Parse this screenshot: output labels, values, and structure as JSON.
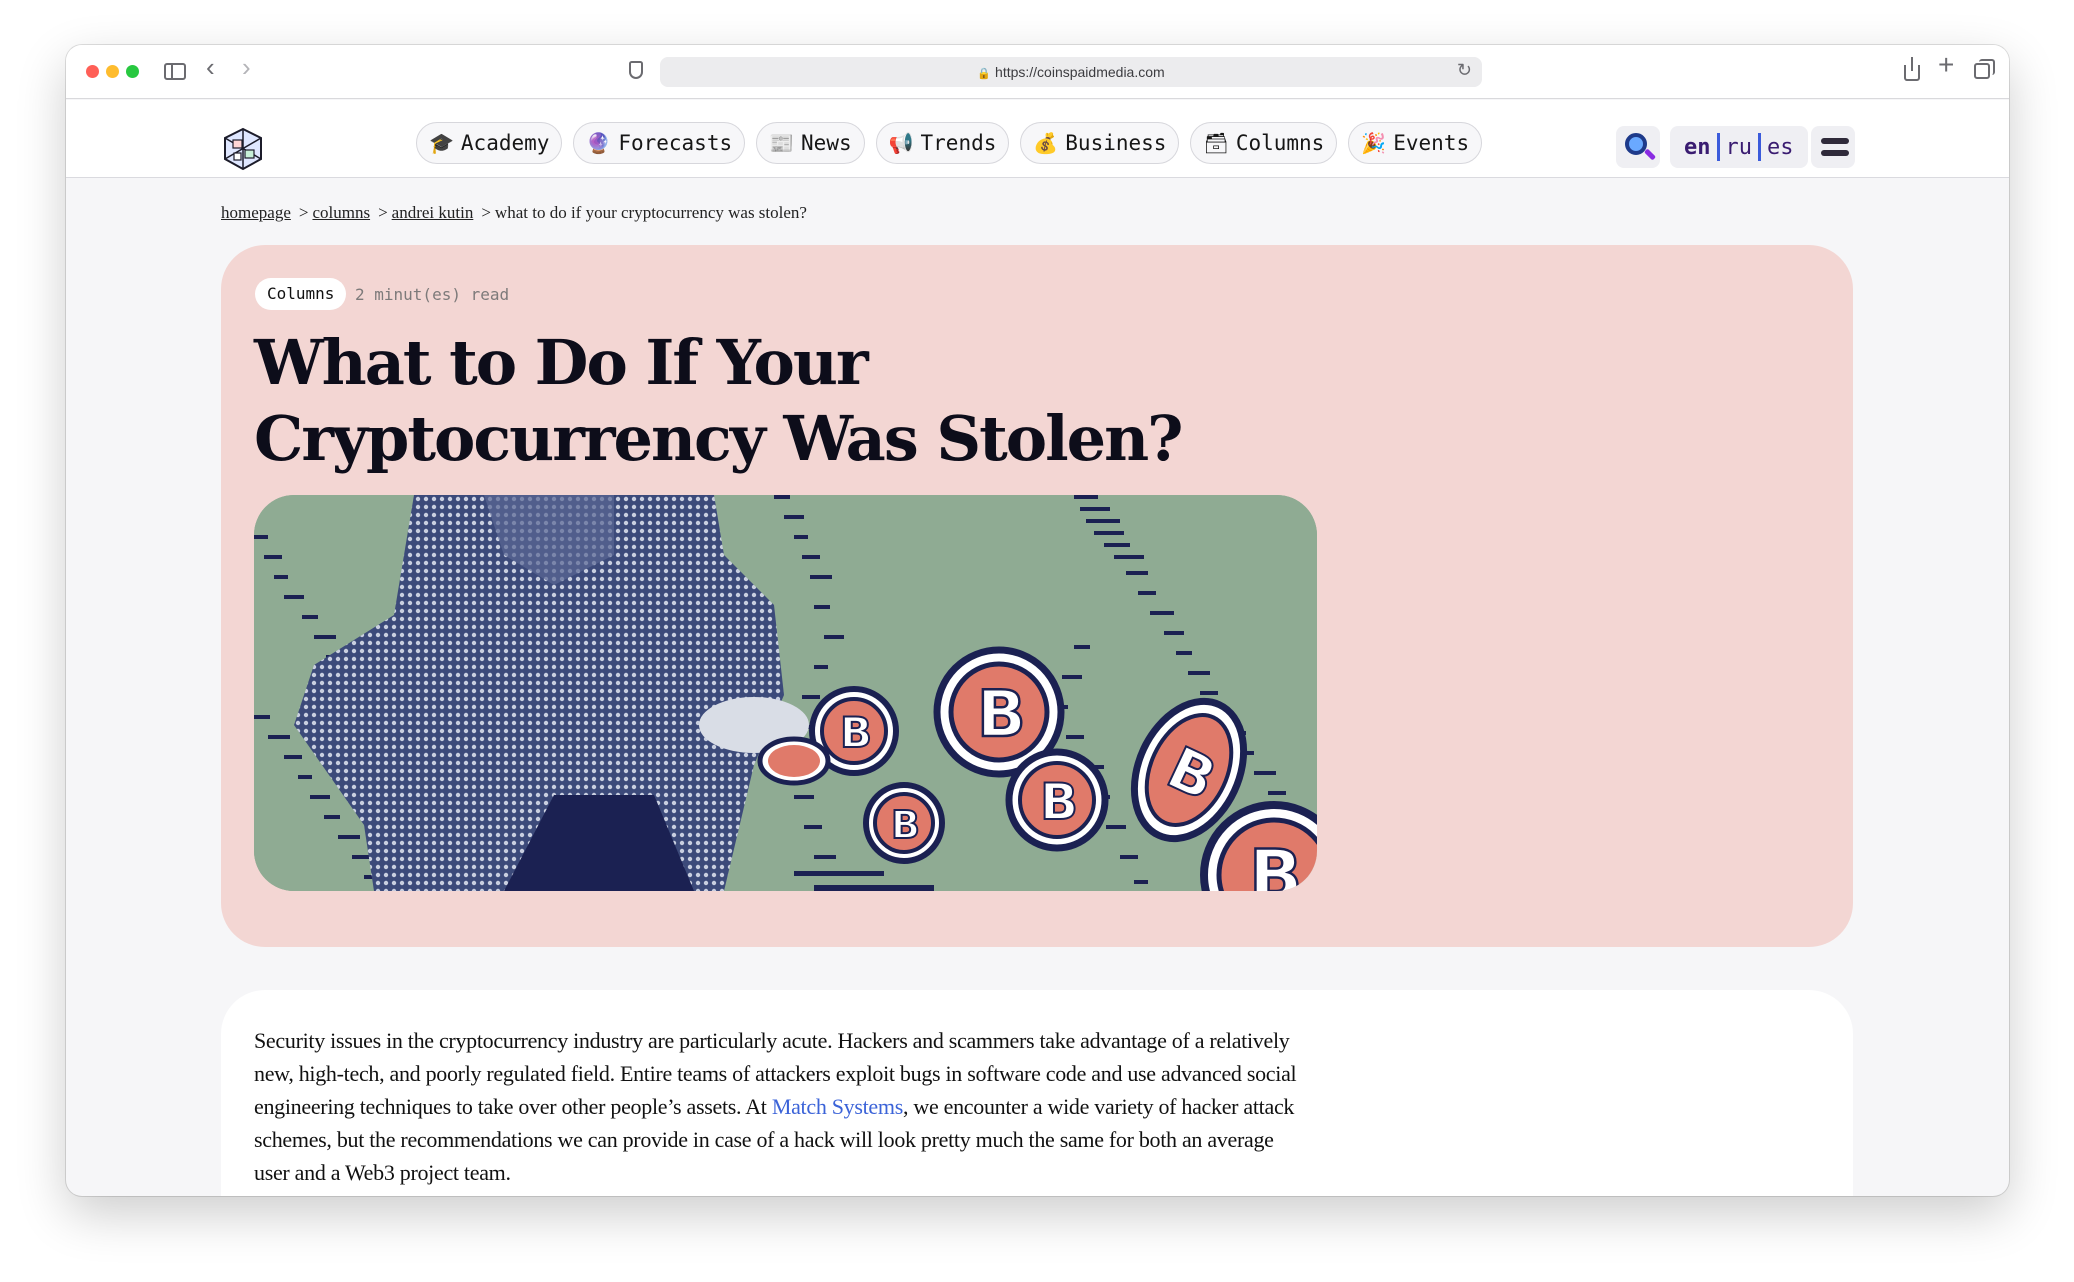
{
  "browser": {
    "url": "https://coinspaidmedia.com"
  },
  "nav": {
    "items": [
      {
        "label": "Academy",
        "icon": "🎓"
      },
      {
        "label": "Forecasts",
        "icon": "🔮"
      },
      {
        "label": "News",
        "icon": "📰"
      },
      {
        "label": "Trends",
        "icon": "📢"
      },
      {
        "label": "Business",
        "icon": "💰"
      },
      {
        "label": "Columns",
        "icon": "🗃"
      },
      {
        "label": "Events",
        "icon": "🎉"
      }
    ],
    "languages": [
      "en",
      "ru",
      "es"
    ],
    "active_language": "en"
  },
  "breadcrumb": {
    "items": [
      "homepage",
      "columns",
      "andrei kutin"
    ],
    "current": "what to do if your cryptocurrency was stolen?",
    "separator": ">"
  },
  "article": {
    "tag": "Columns",
    "read_time": "2 minut(es) read",
    "title": "What to Do If Your Cryptocurrency Was Stolen?",
    "intro_before_link": "Security issues in the cryptocurrency industry are particularly acute. Hackers and scammers take advantage of a relatively new, high-tech, and poorly regulated field. Entire teams of attackers exploit bugs in software code and use advanced social engineering techniques to take over other people’s assets. At ",
    "intro_link": "Match Systems",
    "intro_after_link": ", we encounter a wide variety of hacker attack schemes, but the recommendations we can provide in case of a hack will look pretty much the same for both an average user and a Web3 project team."
  },
  "colors": {
    "hero_bg": "#f3d6d3",
    "image_bg": "#8fab93",
    "link": "#3b63d8",
    "lang": "#3a1c71"
  }
}
